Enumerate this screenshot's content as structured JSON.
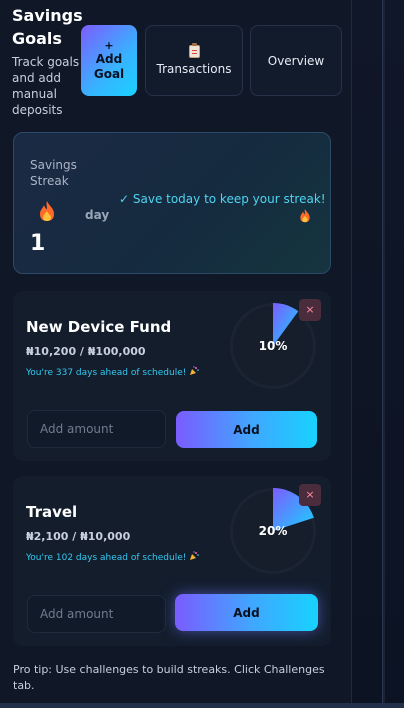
{
  "header": {
    "title": "Savings Goals",
    "subtitle": "Track goals and add manual deposits",
    "add_goal_plus": "+",
    "add_goal_label": "Add Goal",
    "transactions_label": "Transactions",
    "overview_label": "Overview",
    "transactions_icon": "clipboard-icon"
  },
  "streak": {
    "label": "Savings Streak",
    "count": "1",
    "unit": "day",
    "message": "✓ Save today to keep your streak!",
    "icon": "flame-icon"
  },
  "goals": [
    {
      "name": "New Device Fund",
      "amount": "₦10,200 / ₦100,000",
      "ahead": "You're 337 days ahead of schedule!",
      "percent_label": "10%",
      "progress": 0.1,
      "delete_label": "×",
      "input_placeholder": "Add amount",
      "add_label": "Add"
    },
    {
      "name": "Travel",
      "amount": "₦2,100 / ₦10,000",
      "ahead": "You're 102 days ahead of schedule!",
      "percent_label": "20%",
      "progress": 0.2,
      "delete_label": "×",
      "input_placeholder": "Add amount",
      "add_label": "Add"
    }
  ],
  "tip": "Pro tip: Use challenges to build streaks. Click Challenges tab.",
  "colors": {
    "accent_start": "#7c5cff",
    "accent_end": "#18d2ff",
    "ahead_text": "#34c8f0",
    "streak_message": "#4fd4f2"
  }
}
